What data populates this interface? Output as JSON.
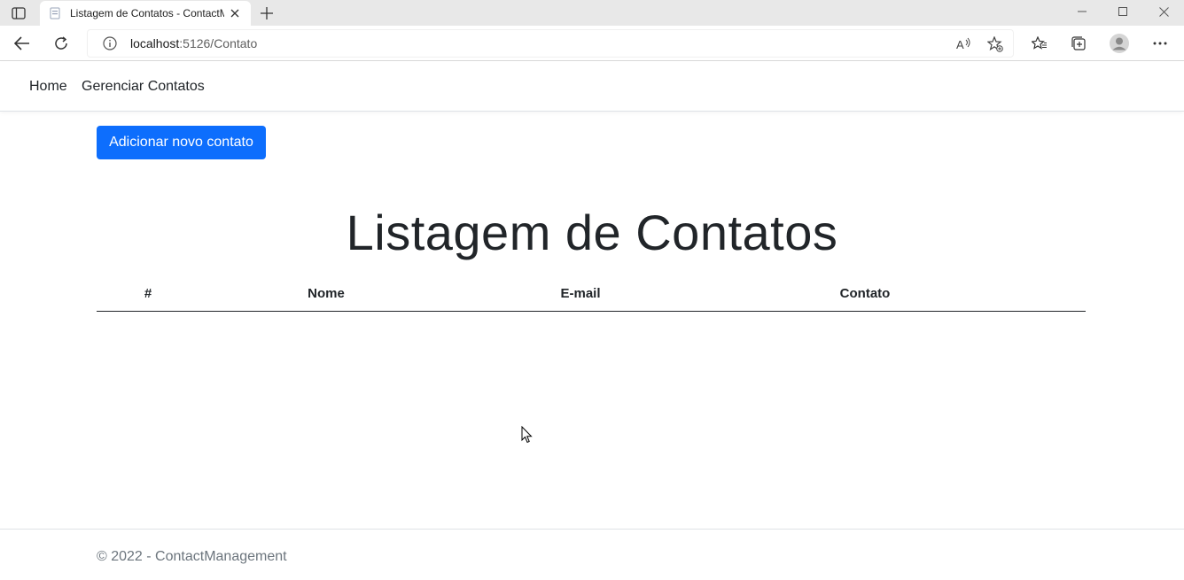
{
  "browser": {
    "tab_title": "Listagem de Contatos - ContactManagement",
    "url_host": "localhost",
    "url_path": ":5126/Contato"
  },
  "nav": {
    "items": [
      {
        "label": "Home"
      },
      {
        "label": "Gerenciar Contatos"
      }
    ]
  },
  "main": {
    "add_button_label": "Adicionar novo contato",
    "page_title": "Listagem de Contatos",
    "table": {
      "columns": [
        "#",
        "Nome",
        "E-mail",
        "Contato"
      ],
      "rows": []
    }
  },
  "footer": {
    "text": "© 2022 - ContactManagement"
  },
  "colors": {
    "primary": "#0d6efd",
    "footer_text": "#6c757d"
  }
}
